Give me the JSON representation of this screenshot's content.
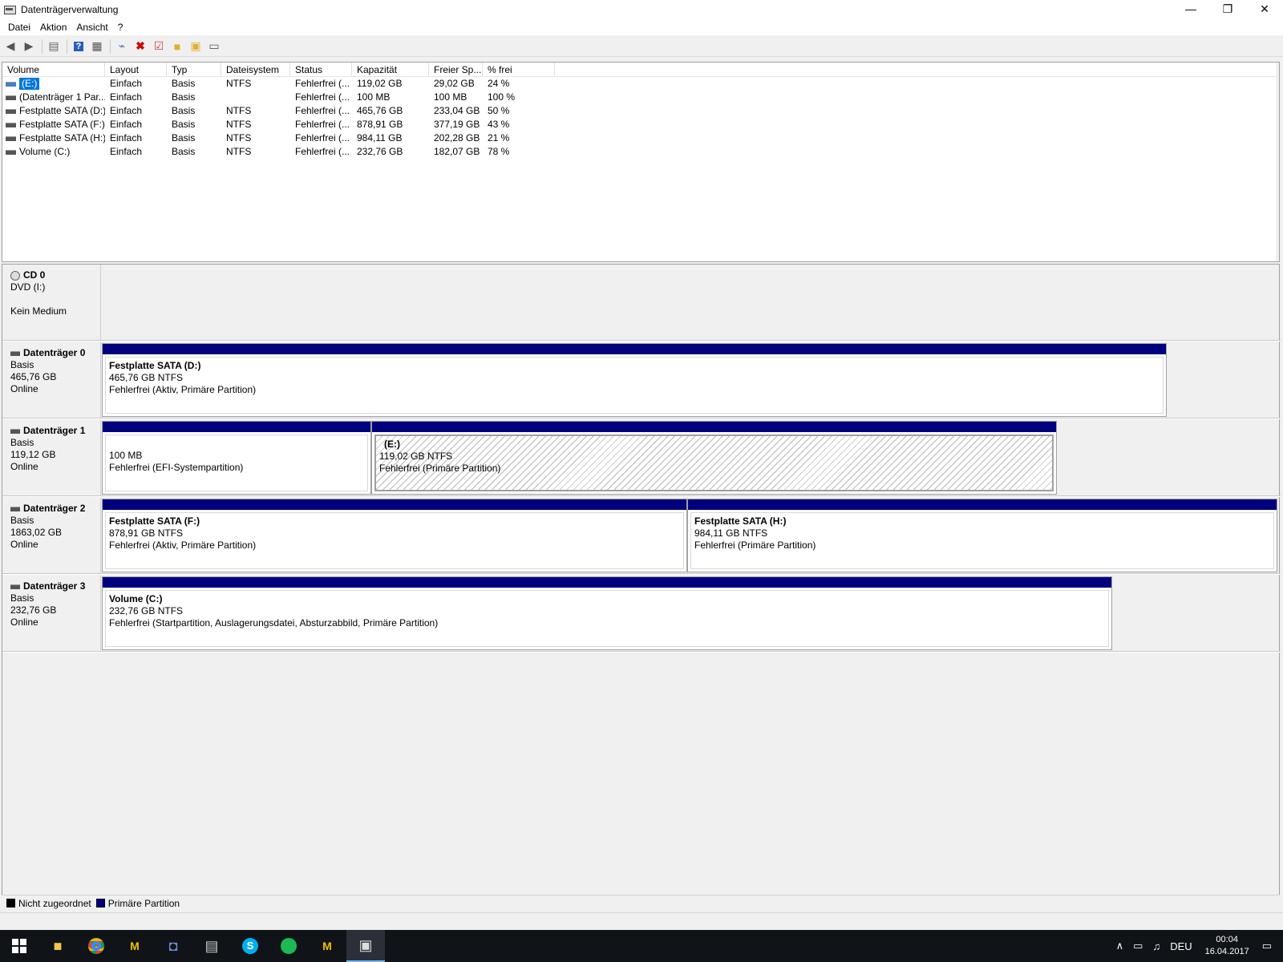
{
  "window": {
    "title": "Datenträgerverwaltung",
    "minimize": "—",
    "restore": "❐",
    "close": "✕"
  },
  "menu": [
    "Datei",
    "Aktion",
    "Ansicht",
    "?"
  ],
  "toolbar": {
    "icons": [
      "back-icon",
      "forward-icon",
      "console-tree-icon",
      "help-icon",
      "properties-icon",
      "connect-icon",
      "delete-icon",
      "check-icon",
      "folder-up-icon",
      "find-icon",
      "settings-icon"
    ]
  },
  "volumes": {
    "columns": [
      "Volume",
      "Layout",
      "Typ",
      "Dateisystem",
      "Status",
      "Kapazität",
      "Freier Sp...",
      "% frei"
    ],
    "rows": [
      [
        "(E:)",
        "Einfach",
        "Basis",
        "NTFS",
        "Fehlerfrei (...",
        "119,02 GB",
        "29,02 GB",
        "24 %"
      ],
      [
        "(Datenträger 1 Par...",
        "Einfach",
        "Basis",
        "",
        "Fehlerfrei (...",
        "100 MB",
        "100 MB",
        "100 %"
      ],
      [
        "Festplatte SATA (D:)",
        "Einfach",
        "Basis",
        "NTFS",
        "Fehlerfrei (...",
        "465,76 GB",
        "233,04 GB",
        "50 %"
      ],
      [
        "Festplatte SATA (F:)",
        "Einfach",
        "Basis",
        "NTFS",
        "Fehlerfrei (...",
        "878,91 GB",
        "377,19 GB",
        "43 %"
      ],
      [
        "Festplatte SATA (H:)",
        "Einfach",
        "Basis",
        "NTFS",
        "Fehlerfrei (...",
        "984,11 GB",
        "202,28 GB",
        "21 %"
      ],
      [
        "Volume (C:)",
        "Einfach",
        "Basis",
        "NTFS",
        "Fehlerfrei (...",
        "232,76 GB",
        "182,07 GB",
        "78 %"
      ]
    ]
  },
  "disks": {
    "cd0": {
      "name": "CD 0",
      "line1": "DVD (I:)",
      "line2": "",
      "line3": "Kein Medium"
    },
    "d0": {
      "name": "Datenträger 0",
      "type": "Basis",
      "size": "465,76 GB",
      "state": "Online",
      "p1": {
        "name": "Festplatte SATA  (D:)",
        "size": "465,76 GB NTFS",
        "status": "Fehlerfrei (Aktiv, Primäre Partition)"
      }
    },
    "d1": {
      "name": "Datenträger 1",
      "type": "Basis",
      "size": "119,12 GB",
      "state": "Online",
      "p1": {
        "size": "100 MB",
        "status": "Fehlerfrei (EFI-Systempartition)"
      },
      "p2": {
        "name": "(E:)",
        "size": "119,02 GB NTFS",
        "status": "Fehlerfrei (Primäre Partition)"
      }
    },
    "d2": {
      "name": "Datenträger 2",
      "type": "Basis",
      "size": "1863,02 GB",
      "state": "Online",
      "p1": {
        "name": "Festplatte SATA  (F:)",
        "size": "878,91 GB NTFS",
        "status": "Fehlerfrei (Aktiv, Primäre Partition)"
      },
      "p2": {
        "name": "Festplatte SATA  (H:)",
        "size": "984,11 GB NTFS",
        "status": "Fehlerfrei (Primäre Partition)"
      }
    },
    "d3": {
      "name": "Datenträger 3",
      "type": "Basis",
      "size": "232,76 GB",
      "state": "Online",
      "p1": {
        "name": "Volume  (C:)",
        "size": "232,76 GB NTFS",
        "status": "Fehlerfrei (Startpartition, Auslagerungsdatei, Absturzabbild, Primäre Partition)"
      }
    }
  },
  "legend": {
    "unallocated": "Nicht zugeordnet",
    "primary": "Primäre Partition",
    "unallocated_color": "#000000",
    "primary_color": "#00007f"
  },
  "taskbar": {
    "apps": [
      "windows-start-icon",
      "file-explorer-icon",
      "chrome-icon",
      "myeclipse-icon",
      "discord-icon",
      "notepad-icon",
      "skype-icon",
      "spotify-icon",
      "myeclipse-icon-2",
      "disk-management-icon"
    ],
    "language": "DEU",
    "time": "00:04",
    "date": "16.04.2017"
  }
}
